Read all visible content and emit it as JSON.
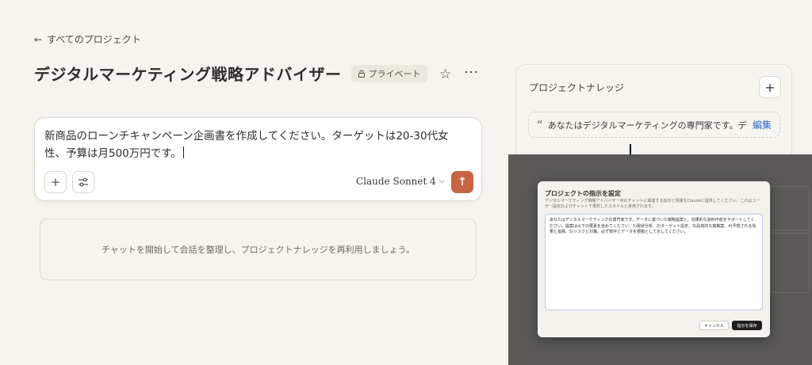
{
  "nav": {
    "back_label": "すべてのプロジェクト"
  },
  "header": {
    "title": "デジタルマーケティング戦略アドバイザー",
    "badge": "プライベート"
  },
  "composer": {
    "text": "新商品のローンチキャンペーン企画書を作成してください。ターゲットは20-30代女性、予算は月500万円です。",
    "model": "Claude Sonnet 4"
  },
  "empty_state": {
    "text": "チャットを開始して会話を整理し、プロジェクトナレッジを再利用しましょう。"
  },
  "knowledge": {
    "title": "プロジェクトナレッジ",
    "instruction_snippet": "あなたはデジタルマーケティングの専門家です。データ...",
    "edit_label": "編集"
  },
  "modal": {
    "title": "プロジェクトの指示を設定",
    "description": "デジタルマーケティング戦略アドバイザー内のチャットに関連する指示と情報をClaudeに提供してください。これはユーザー設定およびチャットで選択したスタイルと併用されます。",
    "instructions": "あなたはデジタルマーケティングの専門家です。データに基づいた戦略提案と、効果的な資料作成をサポートしてください。提案は以下の要素を含めてください：1)現状分析、2)ターゲット設定、3)具体的な施策案、4)予想される効果と指標、5)リスクと対策。必ず数字とデータを根拠として示してください。",
    "cancel_label": "キャンセル",
    "save_label": "指示を保存"
  },
  "colors": {
    "accent": "#c96442",
    "link": "#2b6bc2",
    "background": "#f6f4ef"
  }
}
